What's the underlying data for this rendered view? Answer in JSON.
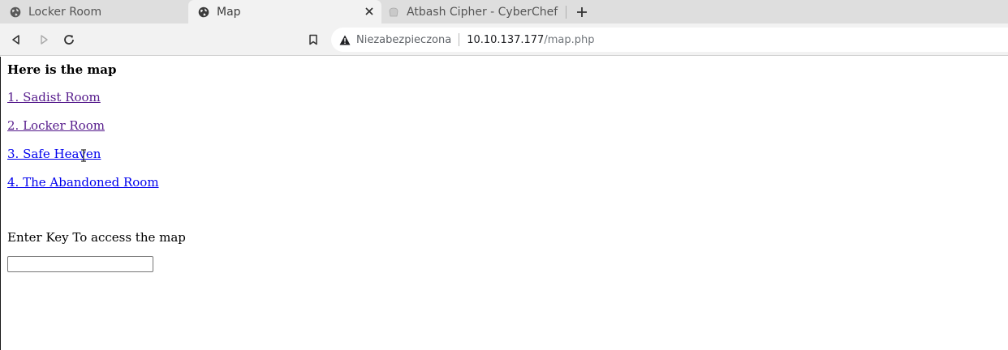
{
  "tabs": [
    {
      "title": "Locker Room",
      "favicon": "globe-icon",
      "active": false
    },
    {
      "title": "Map",
      "favicon": "globe-icon",
      "active": true
    },
    {
      "title": "Atbash Cipher - CyberChef",
      "favicon": "cyberchef-icon",
      "active": false
    }
  ],
  "toolbar": {
    "security_label": "Niezabezpieczona",
    "url_host": "10.10.137.177",
    "url_path": "/map.php"
  },
  "page": {
    "heading": "Here is the map",
    "links": [
      {
        "label": "1. Sadist Room",
        "visited": true
      },
      {
        "label": "2. Locker Room",
        "visited": true
      },
      {
        "label": "3. Safe Heaven",
        "visited": false
      },
      {
        "label": "4. The Abandoned Room",
        "visited": false
      }
    ],
    "key_label": "Enter Key To access the map",
    "key_input_value": ""
  },
  "colors": {
    "link_visited": "#551a8b",
    "link_unvisited": "#0000ee",
    "tabstrip_bg": "#dedede",
    "toolbar_bg": "#f2f2f2"
  }
}
